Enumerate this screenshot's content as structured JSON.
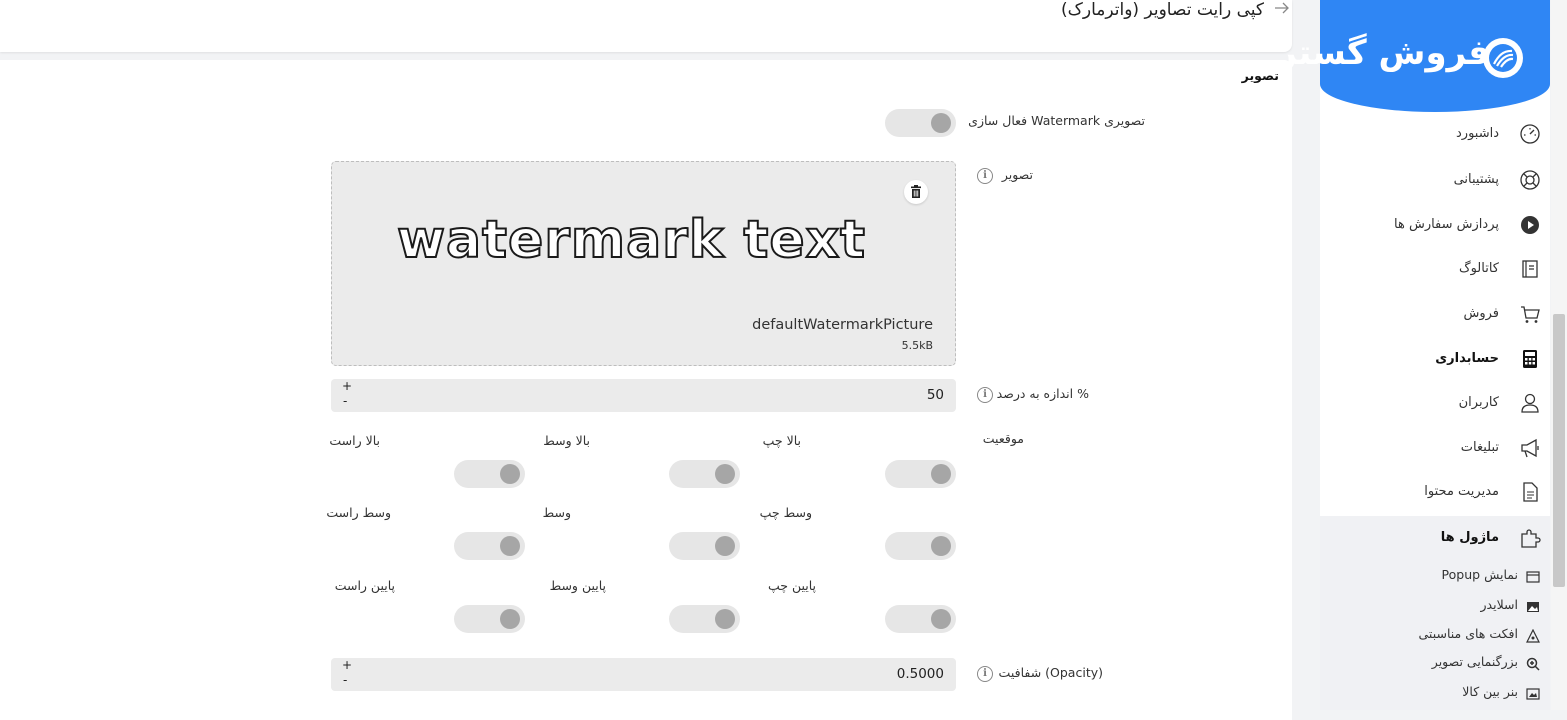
{
  "header": {
    "title": "کپی رایت تصاویر (واترمارک)"
  },
  "brand": {
    "logo_text": "فروش گستر",
    "accent": "#2f86f4"
  },
  "sidebar": {
    "items": [
      {
        "label": "داشبورد",
        "icon": "dashboard-gauge-icon"
      },
      {
        "label": "پشتیبانی",
        "icon": "lifebuoy-icon"
      },
      {
        "label": "پردازش سفارش ها",
        "icon": "play-circle-icon"
      },
      {
        "label": "کاتالوگ",
        "icon": "book-icon"
      },
      {
        "label": "فروش",
        "icon": "cart-icon"
      },
      {
        "label": "حسابداری",
        "icon": "calculator-icon"
      },
      {
        "label": "کاربران",
        "icon": "user-icon"
      },
      {
        "label": "تبلیغات",
        "icon": "megaphone-icon"
      },
      {
        "label": "مدیریت محتوا",
        "icon": "document-icon"
      },
      {
        "label": "ماژول ها",
        "icon": "puzzle-icon"
      }
    ],
    "subitems": [
      {
        "label": "Popup نمایش",
        "icon": "window-icon"
      },
      {
        "label": "اسلایدر",
        "icon": "image-icon"
      },
      {
        "label": "افکت های مناسبتی",
        "icon": "effects-icon"
      },
      {
        "label": "بزرگنمایی تصویر",
        "icon": "zoom-in-icon"
      },
      {
        "label": "بنر بین کالا",
        "icon": "banner-icon"
      }
    ]
  },
  "section": {
    "title": "تصویر"
  },
  "form": {
    "enable_label": "فعال سازی Watermark تصویری",
    "image_label": "تصویر",
    "image": {
      "preview_text": "watermark text",
      "file_name": "defaultWatermarkPicture",
      "file_size": "5.5kB"
    },
    "size_label": "اندازه به درصد %",
    "size_value": "50",
    "position_label": "موقعیت",
    "positions": [
      [
        "بالا چپ",
        "بالا وسط",
        "بالا راست"
      ],
      [
        "وسط چپ",
        "وسط",
        "وسط راست"
      ],
      [
        "پایین چپ",
        "پایین وسط",
        "پایین راست"
      ]
    ],
    "opacity_label": "شفافیت (Opacity)",
    "opacity_value": "0.5000",
    "plus": "+",
    "minus": "-",
    "info": "i"
  }
}
